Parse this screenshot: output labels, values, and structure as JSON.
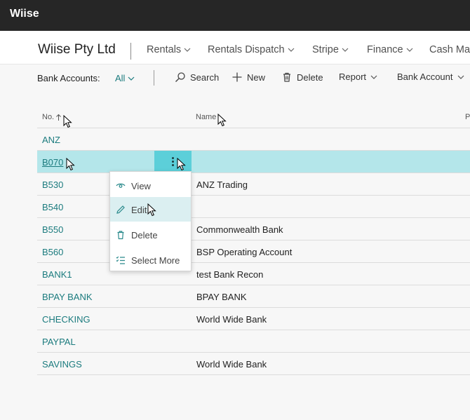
{
  "app": {
    "brand": "Wiise"
  },
  "nav": {
    "company": "Wiise Pty Ltd",
    "items": [
      {
        "label": "Rentals"
      },
      {
        "label": "Rentals Dispatch"
      },
      {
        "label": "Stripe"
      },
      {
        "label": "Finance"
      },
      {
        "label": "Cash Ma"
      }
    ]
  },
  "actionbar": {
    "label": "Bank Accounts:",
    "filter": "All",
    "search": "Search",
    "new": "New",
    "delete": "Delete",
    "report": "Report",
    "bank_account": "Bank Account"
  },
  "table": {
    "columns": {
      "no": "No.",
      "name": "Name",
      "next": "P"
    },
    "rows": [
      {
        "no": "ANZ",
        "name": ""
      },
      {
        "no": "B070",
        "name": ""
      },
      {
        "no": "B530",
        "name": "ANZ Trading"
      },
      {
        "no": "B540",
        "name": ""
      },
      {
        "no": "B550",
        "name": "Commonwealth Bank"
      },
      {
        "no": "B560",
        "name": "BSP Operating Account"
      },
      {
        "no": "BANK1",
        "name": "test Bank Recon"
      },
      {
        "no": "BPAY BANK",
        "name": "BPAY BANK"
      },
      {
        "no": "CHECKING",
        "name": "World Wide Bank"
      },
      {
        "no": "PAYPAL",
        "name": ""
      },
      {
        "no": "SAVINGS",
        "name": "World Wide Bank"
      }
    ]
  },
  "context_menu": {
    "items": [
      {
        "label": "View",
        "icon": "eye-icon"
      },
      {
        "label": "Edit",
        "icon": "pencil-icon"
      },
      {
        "label": "Delete",
        "icon": "trash-icon"
      },
      {
        "label": "Select More",
        "icon": "checklist-icon"
      }
    ]
  },
  "colors": {
    "topbar": "#262626",
    "accent": "#1b7b7e",
    "selected_row": "#b4e6ea",
    "dots_cell": "#5ccfd9"
  }
}
